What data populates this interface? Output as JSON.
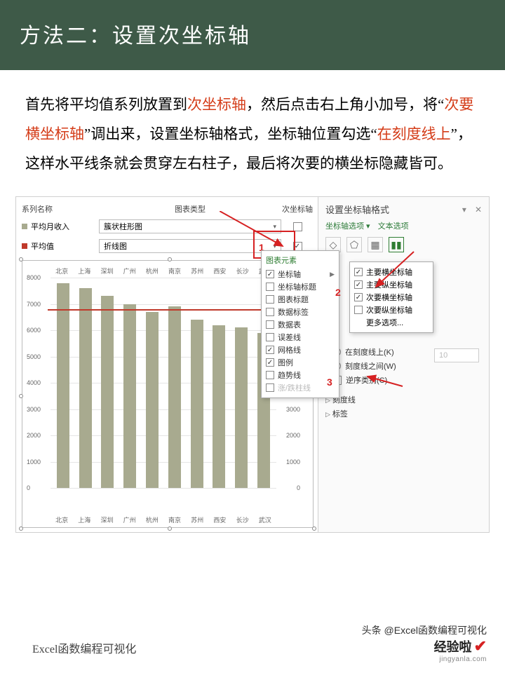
{
  "title": "方法二：设置次坐标轴",
  "para": {
    "t1": "首先将平均值系列放置到",
    "h1": "次坐标轴",
    "t2": "，然后点击右上角小加号，将“",
    "h2": "次要横坐标轴",
    "t3": "”调出来，设置坐标轴格式，坐标轴位置勾选“",
    "h3": "在刻度线上",
    "t4": "”，这样水平线条就会贯穿左右柱子，最后将次要的横坐标隐藏皆可。"
  },
  "tbl": {
    "hd": {
      "c1": "系列名称",
      "c2": "图表类型",
      "c3": "次坐标轴"
    },
    "r1": {
      "name": "平均月收入",
      "type": "簇状柱形图",
      "checked": false,
      "color": "#a8aa8f"
    },
    "r2": {
      "name": "平均值",
      "type": "折线图",
      "checked": true,
      "color": "#c0392b"
    }
  },
  "steps": {
    "s1": "1",
    "s2": "2",
    "s3": "3"
  },
  "right": {
    "title": "设置坐标轴格式",
    "dd": "▾",
    "close": "✕",
    "sub": "坐标轴选项 ▾　文本选项"
  },
  "pop1": {
    "hd": "图表元素",
    "items": [
      {
        "label": "坐标轴",
        "checked": true,
        "arrow": true
      },
      {
        "label": "坐标轴标题",
        "checked": false
      },
      {
        "label": "图表标题",
        "checked": false
      },
      {
        "label": "数据标签",
        "checked": false
      },
      {
        "label": "数据表",
        "checked": false
      },
      {
        "label": "误差线",
        "checked": false
      },
      {
        "label": "网格线",
        "checked": true
      },
      {
        "label": "图例",
        "checked": true
      },
      {
        "label": "趋势线",
        "checked": false
      },
      {
        "label": "涨/跌柱线",
        "checked": false,
        "dis": true
      }
    ]
  },
  "pop2": {
    "items": [
      {
        "label": "主要横坐标轴",
        "checked": true
      },
      {
        "label": "主要纵坐标轴",
        "checked": true
      },
      {
        "label": "次要横坐标轴",
        "checked": true
      },
      {
        "label": "次要纵坐标轴",
        "checked": false
      },
      {
        "label": "更多选项...",
        "checked": null
      }
    ]
  },
  "axis": {
    "r1": "在刻度线上(K)",
    "r2": "刻度线之间(W)",
    "r3": "逆序类别(C)",
    "sec1": "刻度线",
    "sec2": "标签",
    "num": "10"
  },
  "chart_data": {
    "type": "bar",
    "categories": [
      "北京",
      "上海",
      "深圳",
      "广州",
      "杭州",
      "南京",
      "苏州",
      "西安",
      "长沙",
      "武汉"
    ],
    "values": [
      7800,
      7600,
      7300,
      7000,
      6700,
      6900,
      6400,
      6200,
      6100,
      5900
    ],
    "average": 6800,
    "ylabel": "",
    "xlabel": "",
    "ylim": [
      0,
      8000
    ],
    "y2lim": [
      0,
      8000
    ],
    "yticks": [
      0,
      1000,
      2000,
      3000,
      4000,
      5000,
      6000,
      7000,
      8000
    ],
    "title": ""
  },
  "footer": {
    "left": "Excel函数编程可视化",
    "r1": "头条 @Excel函数编程可视化",
    "r2": "经验啦",
    "r3": "jingyanla.com"
  }
}
